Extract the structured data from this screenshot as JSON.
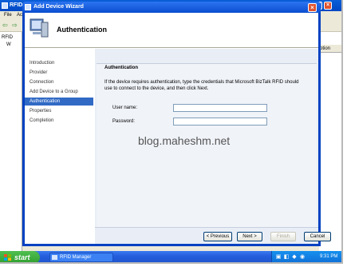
{
  "background_app": {
    "title": "RFID",
    "menu": [
      "File",
      "Ac"
    ],
    "tree_items": [
      "RFID",
      "W"
    ],
    "right_column_header": "ption"
  },
  "wizard": {
    "title": "Add Device Wizard",
    "header_title": "Authentication",
    "nav_items": [
      {
        "label": "Introduction",
        "active": false
      },
      {
        "label": "Provider",
        "active": false
      },
      {
        "label": "Connection",
        "active": false
      },
      {
        "label": "Add Device to a Group",
        "active": false
      },
      {
        "label": "Authentication",
        "active": true
      },
      {
        "label": "Properties",
        "active": false
      },
      {
        "label": "Completion",
        "active": false
      }
    ],
    "section_title": "Authentication",
    "section_description": "If the device requires authentication, type the credentials that Microsoft BizTalk RFID should use to connect to the device, and then click Next.",
    "fields": {
      "username_label": "User name:",
      "username_value": "",
      "password_label": "Password:",
      "password_value": ""
    },
    "watermark": "blog.maheshm.net",
    "buttons": {
      "previous": "< Previous",
      "next": "Next >",
      "finish": "Finish",
      "cancel": "Cancel"
    }
  },
  "taskbar": {
    "start_label": "start",
    "task_item_label": "RFID Manager",
    "clock": "9:31 PM"
  },
  "colors": {
    "titlebar": "#0b4ed0",
    "nav_active": "#316ac5",
    "taskbar": "#245edb",
    "start_button": "#2f9e2f"
  }
}
